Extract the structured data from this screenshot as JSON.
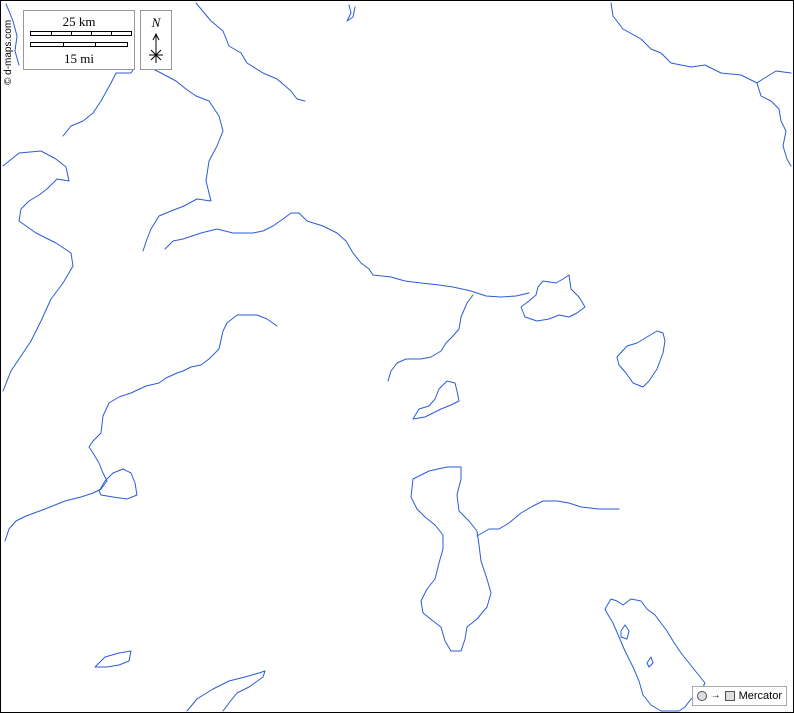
{
  "map": {
    "copyright": "© d-maps.com",
    "scale": {
      "km_label": "25 km",
      "mi_label": "15 mi"
    },
    "north_label": "N",
    "projection_label": "Mercator",
    "water_color": "#2a5bd7",
    "icons": [
      "compass-rose-icon",
      "globe-icon",
      "arrow-right-icon",
      "map-plane-icon"
    ]
  }
}
